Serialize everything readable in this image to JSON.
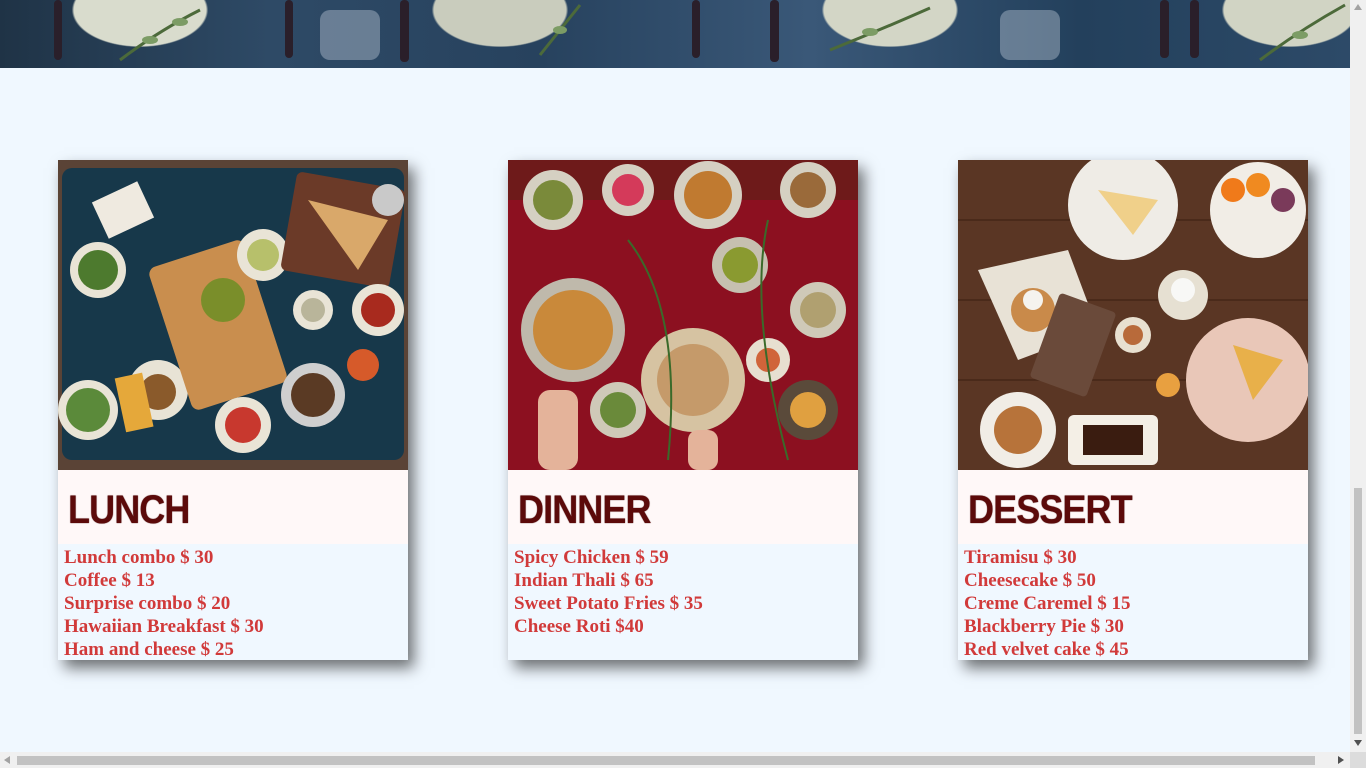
{
  "hero": {
    "icon": "table-setting-banner"
  },
  "cards": [
    {
      "title": "LUNCH",
      "items": [
        "Lunch combo $ 30",
        "Coffee $ 13",
        "Surprise combo $ 20",
        "Hawaiian Breakfast $ 30",
        "Ham and cheese $ 25"
      ]
    },
    {
      "title": "DINNER",
      "items": [
        "Spicy Chicken $ 59",
        "Indian Thali $ 65",
        "Sweet Potato Fries $ 35",
        "Cheese Roti $40"
      ]
    },
    {
      "title": "DESSERT",
      "items": [
        "Tiramisu $ 30",
        "Cheesecake $ 50",
        "Creme Caremel $ 15",
        "Blackberry Pie $ 30",
        "Red velvet cake $ 45"
      ]
    }
  ],
  "colors": {
    "title": "#5c0a0a",
    "item": "#d13a3a",
    "page_bg": "#f0f8ff"
  }
}
